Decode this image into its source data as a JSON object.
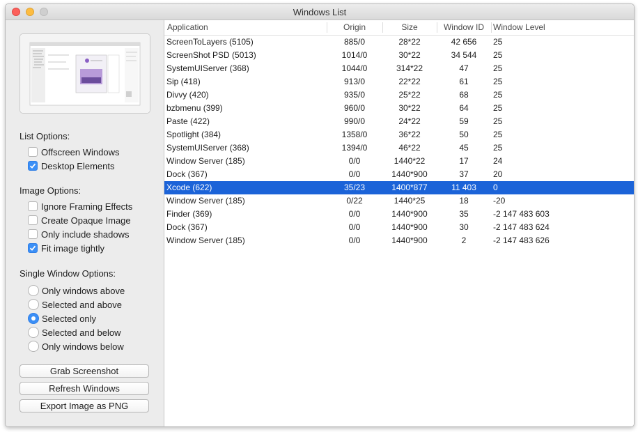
{
  "window": {
    "title": "Windows List"
  },
  "sidebar": {
    "list_options_label": "List Options:",
    "list_options": [
      {
        "label": "Offscreen Windows",
        "checked": false
      },
      {
        "label": "Desktop Elements",
        "checked": true
      }
    ],
    "image_options_label": "Image Options:",
    "image_options": [
      {
        "label": "Ignore Framing Effects",
        "checked": false
      },
      {
        "label": "Create Opaque Image",
        "checked": false
      },
      {
        "label": "Only include shadows",
        "checked": false
      },
      {
        "label": "Fit image tightly",
        "checked": true
      }
    ],
    "single_window_label": "Single Window Options:",
    "single_window_options": [
      {
        "label": "Only windows above",
        "selected": false
      },
      {
        "label": "Selected and above",
        "selected": false
      },
      {
        "label": "Selected only",
        "selected": true
      },
      {
        "label": "Selected and below",
        "selected": false
      },
      {
        "label": "Only windows below",
        "selected": false
      }
    ],
    "buttons": {
      "grab": "Grab Screenshot",
      "refresh": "Refresh Windows",
      "export": "Export Image as PNG"
    }
  },
  "table": {
    "columns": [
      "Application",
      "Origin",
      "Size",
      "Window ID",
      "Window Level"
    ],
    "selected_index": 11,
    "rows": [
      {
        "app": "ScreenToLayers (5105)",
        "origin": "885/0",
        "size": "28*22",
        "id": "42 656",
        "level": "25"
      },
      {
        "app": "ScreenShot PSD (5013)",
        "origin": "1014/0",
        "size": "30*22",
        "id": "34 544",
        "level": "25"
      },
      {
        "app": "SystemUIServer (368)",
        "origin": "1044/0",
        "size": "314*22",
        "id": "47",
        "level": "25"
      },
      {
        "app": "Sip (418)",
        "origin": "913/0",
        "size": "22*22",
        "id": "61",
        "level": "25"
      },
      {
        "app": "Divvy (420)",
        "origin": "935/0",
        "size": "25*22",
        "id": "68",
        "level": "25"
      },
      {
        "app": "bzbmenu (399)",
        "origin": "960/0",
        "size": "30*22",
        "id": "64",
        "level": "25"
      },
      {
        "app": "Paste (422)",
        "origin": "990/0",
        "size": "24*22",
        "id": "59",
        "level": "25"
      },
      {
        "app": "Spotlight (384)",
        "origin": "1358/0",
        "size": "36*22",
        "id": "50",
        "level": "25"
      },
      {
        "app": "SystemUIServer (368)",
        "origin": "1394/0",
        "size": "46*22",
        "id": "45",
        "level": "25"
      },
      {
        "app": "Window Server (185)",
        "origin": "0/0",
        "size": "1440*22",
        "id": "17",
        "level": "24"
      },
      {
        "app": "Dock (367)",
        "origin": "0/0",
        "size": "1440*900",
        "id": "37",
        "level": "20"
      },
      {
        "app": "Xcode (622)",
        "origin": "35/23",
        "size": "1400*877",
        "id": "11 403",
        "level": "0"
      },
      {
        "app": "Window Server (185)",
        "origin": "0/22",
        "size": "1440*25",
        "id": "18",
        "level": "-20"
      },
      {
        "app": "Finder (369)",
        "origin": "0/0",
        "size": "1440*900",
        "id": "35",
        "level": "-2 147 483 603"
      },
      {
        "app": "Dock (367)",
        "origin": "0/0",
        "size": "1440*900",
        "id": "30",
        "level": "-2 147 483 624"
      },
      {
        "app": "Window Server (185)",
        "origin": "0/0",
        "size": "1440*900",
        "id": "2",
        "level": "-2 147 483 626"
      }
    ]
  },
  "colors": {
    "selection": "#1b63d8",
    "accent": "#3b8ff6"
  }
}
